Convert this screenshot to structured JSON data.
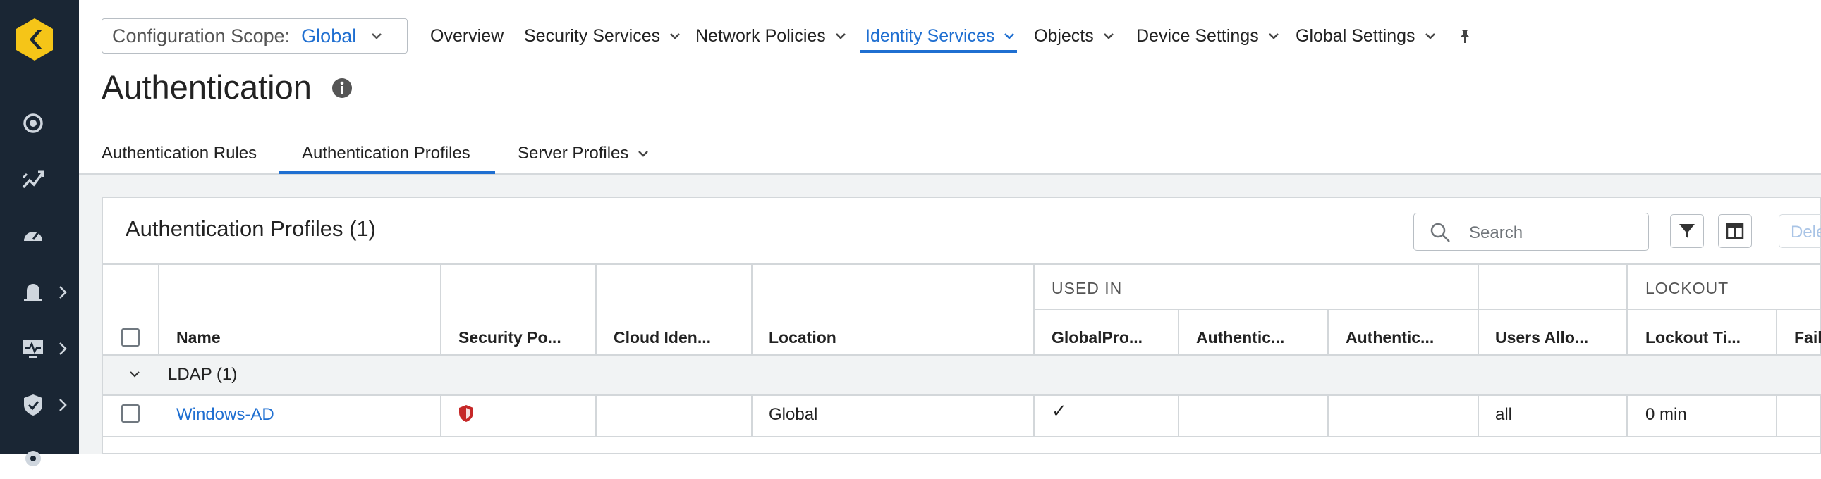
{
  "colors": {
    "rail_bg": "#1a2634",
    "accent": "#1f6fd1",
    "logo": "#f5c518",
    "shield": "#c62828"
  },
  "sidebar": {
    "logo_icon": "brand-hexagon-logo",
    "items": [
      {
        "icon": "dashboard-target-icon",
        "has_submenu": false
      },
      {
        "icon": "activity-chart-icon",
        "has_submenu": false
      },
      {
        "icon": "speedometer-icon",
        "has_submenu": false
      },
      {
        "icon": "alert-bell-icon",
        "has_submenu": true
      },
      {
        "icon": "monitor-icon",
        "has_submenu": true
      },
      {
        "icon": "shield-check-icon",
        "has_submenu": true
      },
      {
        "icon": "settings-icon",
        "has_submenu": false
      }
    ]
  },
  "scope": {
    "label": "Configuration Scope:",
    "value": "Global"
  },
  "topnav": {
    "items": [
      {
        "label": "Overview",
        "dropdown": false
      },
      {
        "label": "Security Services",
        "dropdown": true
      },
      {
        "label": "Network Policies",
        "dropdown": true
      },
      {
        "label": "Identity Services",
        "dropdown": true,
        "active": true
      },
      {
        "label": "Objects",
        "dropdown": true
      },
      {
        "label": "Device Settings",
        "dropdown": true
      },
      {
        "label": "Global Settings",
        "dropdown": true
      }
    ],
    "pin_icon": "pin-icon"
  },
  "page": {
    "title": "Authentication"
  },
  "tabs": [
    {
      "label": "Authentication Rules"
    },
    {
      "label": "Authentication Profiles",
      "active": true
    },
    {
      "label": "Server Profiles",
      "dropdown": true
    }
  ],
  "card": {
    "title": "Authentication Profiles (1)",
    "search_placeholder": "Search",
    "delete_label": "Delete"
  },
  "table": {
    "group_headers": {
      "used_in": "USED IN",
      "lockout": "LOCKOUT"
    },
    "columns": [
      "Name",
      "Security Po...",
      "Cloud Iden...",
      "Location",
      "GlobalPro...",
      "Authentic...",
      "Authentic...",
      "Users Allo...",
      "Lockout Ti...",
      "Fail"
    ],
    "group": {
      "label": "LDAP (1)"
    },
    "rows": [
      {
        "name": "Windows-AD",
        "security_policy": "shield-icon",
        "cloud_identity": "",
        "location": "Global",
        "globalprotect": "✓",
        "auth1": "",
        "auth2": "",
        "users_allowed": "all",
        "lockout_time": "0 min",
        "failed": ""
      }
    ]
  }
}
